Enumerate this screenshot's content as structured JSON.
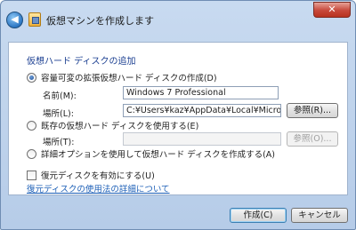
{
  "window": {
    "title": "仮想マシンを作成します",
    "close_glyph": "✕",
    "back_glyph": "◀"
  },
  "section": {
    "title": "仮想ハード ディスクの追加"
  },
  "options": {
    "create_dynamic": {
      "label": "容量可変の拡張仮想ハード ディスクの作成(D)",
      "checked": true,
      "name_label": "名前(M):",
      "name_value": "Windows 7 Professional",
      "location_label": "場所(L):",
      "location_value": "C:¥Users¥kaz¥AppData¥Local¥Microsoft¥Windows Vir",
      "browse_label": "参照(R)..."
    },
    "use_existing": {
      "label": "既存の仮想ハード ディスクを使用する(E)",
      "checked": false,
      "location_label": "場所(T):",
      "location_value": "",
      "browse_label": "参照(O)..."
    },
    "advanced": {
      "label": "詳細オプションを使用して仮想ハード ディスクを作成する(A)",
      "checked": false
    }
  },
  "undo_disk": {
    "label": "復元ディスクを有効にする(U)",
    "checked": false,
    "link_text": "復元ディスクの使用法の詳細について"
  },
  "footer": {
    "create_label": "作成(C)",
    "cancel_label": "キャンセル"
  }
}
